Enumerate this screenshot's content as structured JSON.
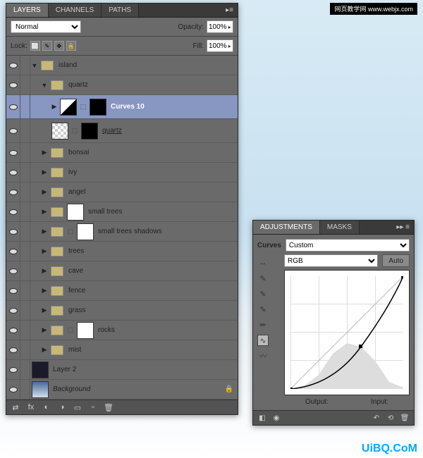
{
  "watermarks": {
    "top": "网页教学网\nwww.webjx.com",
    "bottom": "UiBQ.CoM"
  },
  "layersPanel": {
    "tabs": [
      "LAYERS",
      "CHANNELS",
      "PATHS"
    ],
    "activeTab": 0,
    "blendMode": "Normal",
    "opacityLabel": "Opacity:",
    "opacityValue": "100%",
    "lockLabel": "Lock:",
    "fillLabel": "Fill:",
    "fillValue": "100%",
    "layers": [
      {
        "type": "group",
        "name": "island",
        "open": true,
        "depth": 0
      },
      {
        "type": "group",
        "name": "quartz",
        "open": true,
        "depth": 1
      },
      {
        "type": "adj",
        "name": "Curves 10",
        "depth": 2,
        "selected": true,
        "masked": true
      },
      {
        "type": "layer",
        "name": "quartz",
        "depth": 2,
        "ul": true,
        "checker": true,
        "masked": true
      },
      {
        "type": "group",
        "name": "bonsai",
        "depth": 1
      },
      {
        "type": "group",
        "name": "ivy",
        "depth": 1
      },
      {
        "type": "group",
        "name": "angel",
        "depth": 1
      },
      {
        "type": "group",
        "name": "small trees",
        "depth": 1,
        "thumb": "white"
      },
      {
        "type": "group",
        "name": "small trees shadows",
        "depth": 1,
        "thumb": "white",
        "link": true
      },
      {
        "type": "group",
        "name": "trees",
        "depth": 1
      },
      {
        "type": "group",
        "name": "cave",
        "depth": 1
      },
      {
        "type": "group",
        "name": "fence",
        "depth": 1
      },
      {
        "type": "group",
        "name": "grass",
        "depth": 1
      },
      {
        "type": "group",
        "name": "rocks",
        "depth": 1,
        "thumb": "white",
        "link": true
      },
      {
        "type": "group",
        "name": "mist",
        "depth": 1
      },
      {
        "type": "layer",
        "name": "Layer 2",
        "depth": -1,
        "thumb": "dark"
      },
      {
        "type": "layer",
        "name": "Background",
        "depth": -1,
        "thumb": "sky",
        "italic": true,
        "locked": true
      }
    ],
    "statusIcons": [
      "link",
      "fx",
      "mask",
      "adj",
      "group",
      "new",
      "trash"
    ]
  },
  "adjPanel": {
    "tabs": [
      "ADJUSTMENTS",
      "MASKS"
    ],
    "activeTab": 0,
    "type": "Curves",
    "preset": "Custom",
    "channel": "RGB",
    "autoLabel": "Auto",
    "outputLabel": "Output:",
    "inputLabel": "Input:",
    "tools": [
      "hand",
      "eyedrop",
      "eyedrop-plus",
      "eyedrop-minus",
      "pencil",
      "curve",
      "smooth"
    ]
  }
}
